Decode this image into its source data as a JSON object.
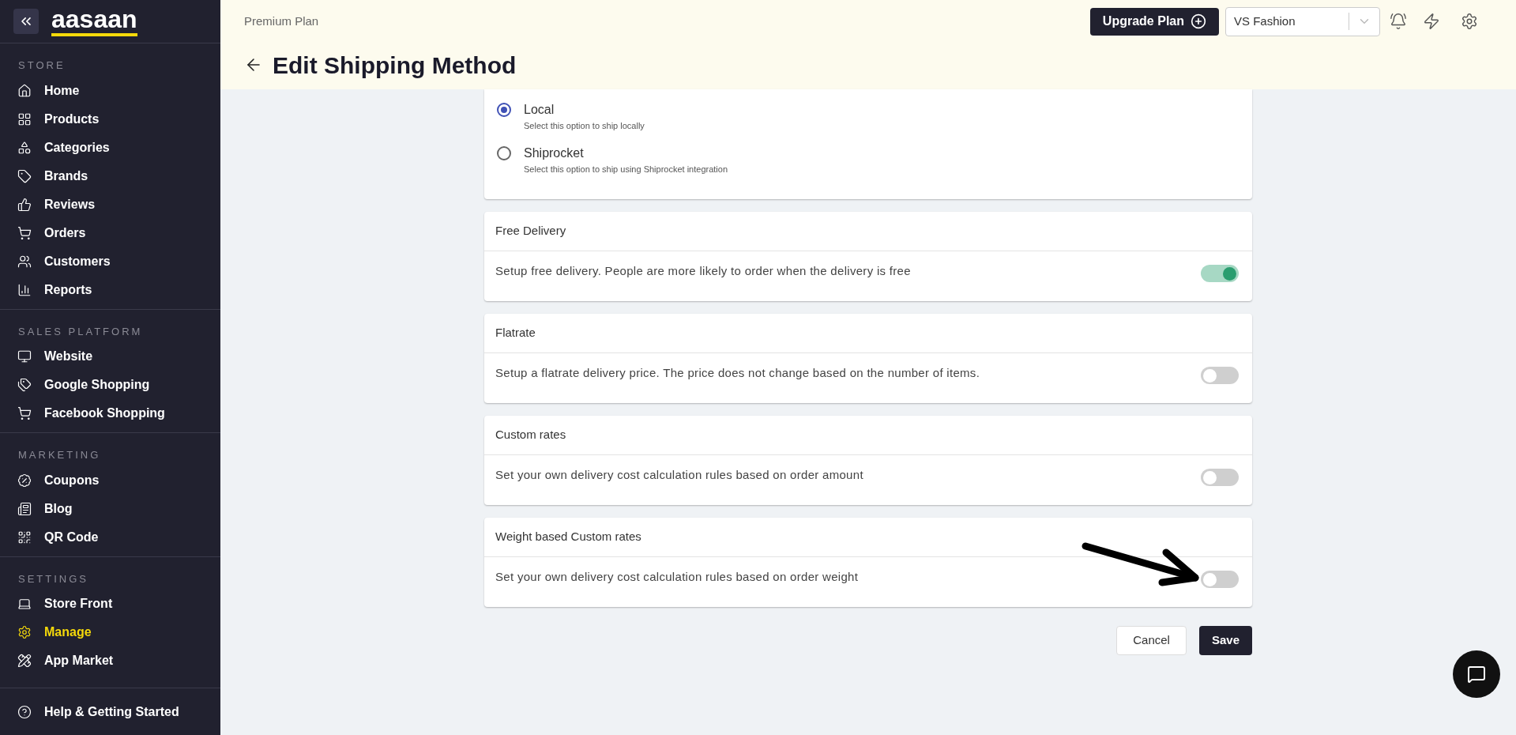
{
  "sidebar": {
    "logo": "aasaan",
    "sections": [
      {
        "label": "STORE",
        "items": [
          {
            "label": "Home",
            "selected": false
          },
          {
            "label": "Products",
            "selected": false
          },
          {
            "label": "Categories",
            "selected": false
          },
          {
            "label": "Brands",
            "selected": false
          },
          {
            "label": "Reviews",
            "selected": false
          },
          {
            "label": "Orders",
            "selected": false
          },
          {
            "label": "Customers",
            "selected": false
          },
          {
            "label": "Reports",
            "selected": false
          }
        ]
      },
      {
        "label": "SALES PLATFORM",
        "items": [
          {
            "label": "Website",
            "selected": false
          },
          {
            "label": "Google Shopping",
            "selected": false
          },
          {
            "label": "Facebook Shopping",
            "selected": false
          }
        ]
      },
      {
        "label": "MARKETING",
        "items": [
          {
            "label": "Coupons",
            "selected": false
          },
          {
            "label": "Blog",
            "selected": false
          },
          {
            "label": "QR Code",
            "selected": false
          }
        ]
      },
      {
        "label": "SETTINGS",
        "items": [
          {
            "label": "Store Front",
            "selected": false
          },
          {
            "label": "Manage",
            "selected": true
          },
          {
            "label": "App Market",
            "selected": false
          }
        ]
      }
    ],
    "help": "Help & Getting Started"
  },
  "header": {
    "plan": "Premium Plan",
    "title": "Edit Shipping Method",
    "upgrade_button": "Upgrade Plan",
    "store_select": {
      "value": "VS Fashion"
    }
  },
  "shipping_options": [
    {
      "label": "Local",
      "description": "Select this option to ship locally",
      "selected": true
    },
    {
      "label": "Shiprocket",
      "description": "Select this option to ship using Shiprocket integration",
      "selected": false
    }
  ],
  "delivery_settings": [
    {
      "title": "Free Delivery",
      "description": "Setup free delivery. People are more likely to order when the delivery is free",
      "on": true
    },
    {
      "title": "Flatrate",
      "description": "Setup a flatrate delivery price. The price does not change based on the number of items.",
      "on": false
    },
    {
      "title": "Custom rates",
      "description": "Set your own delivery cost calculation rules based on order amount",
      "on": false
    },
    {
      "title": "Weight based Custom rates",
      "description": "Set your own delivery cost calculation rules based on order weight",
      "on": false
    }
  ],
  "actions": {
    "cancel": "Cancel",
    "save": "Save"
  }
}
